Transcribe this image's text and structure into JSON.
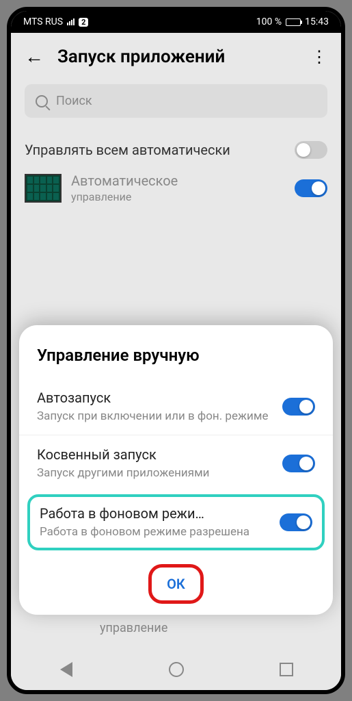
{
  "status": {
    "carrier": "MTS RUS",
    "sim": "2",
    "battery": "100 %",
    "time": "15:43"
  },
  "header": {
    "title": "Запуск приложений"
  },
  "search": {
    "placeholder": "Поиск"
  },
  "settings": {
    "manage_all": "Управлять всем автоматически",
    "app_auto_title": "Автоматическое",
    "app_auto_sub": "управление"
  },
  "dialog": {
    "title": "Управление вручную",
    "rows": [
      {
        "title": "Автозапуск",
        "sub": "Запуск при включении или в фон. режиме"
      },
      {
        "title": "Косвенный запуск",
        "sub": "Запуск другими приложениями"
      },
      {
        "title": "Работа в фоновом режи…",
        "sub": "Работа в фоновом режиме разрешена"
      }
    ],
    "ok": "ОК"
  },
  "bg_below": "управление"
}
